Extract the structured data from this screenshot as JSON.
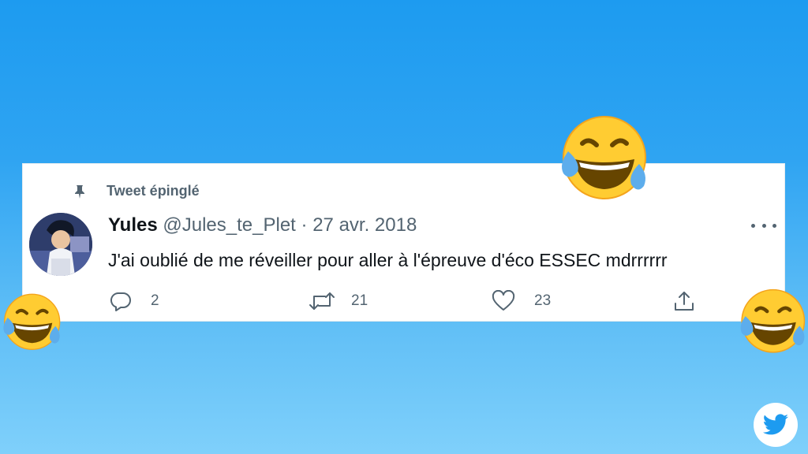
{
  "tweet": {
    "pinned_label": "Tweet épinglé",
    "author_name": "Yules",
    "author_handle": "@Jules_te_Plet",
    "separator": "·",
    "date": "27 avr. 2018",
    "text": "J'ai oublié de me réveiller pour aller à l'épreuve d'éco ESSEC mdrrrrrr",
    "replies": "2",
    "retweets": "21",
    "likes": "23"
  },
  "icons": {
    "pin": "pin-icon",
    "reply": "reply-icon",
    "retweet": "retweet-icon",
    "like": "heart-icon",
    "share": "share-icon",
    "more": "more-icon",
    "emoji": "laughing-crying-emoji",
    "brand": "twitter-bird-icon"
  },
  "colors": {
    "brand_blue": "#1d9bf0",
    "secondary_text": "#536471",
    "primary_text": "#0f1419"
  }
}
